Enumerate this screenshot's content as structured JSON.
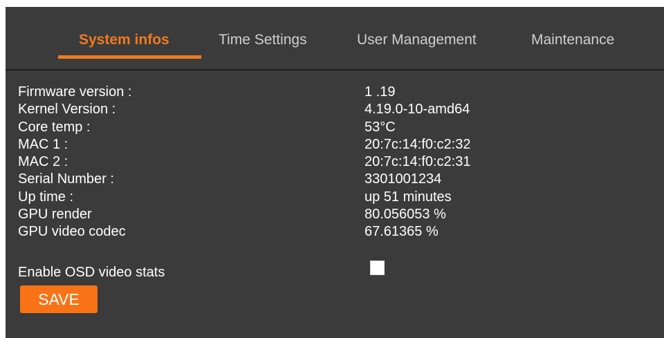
{
  "tabs": [
    {
      "label": "System infos",
      "active": true
    },
    {
      "label": "Time Settings",
      "active": false
    },
    {
      "label": "User Management",
      "active": false
    },
    {
      "label": "Maintenance",
      "active": false
    }
  ],
  "system_info": {
    "rows": [
      {
        "label": "Firmware version :",
        "value": "1 .19"
      },
      {
        "label": "Kernel Version :",
        "value": "4.19.0-10-amd64"
      },
      {
        "label": "Core temp :",
        "value": "53°C"
      },
      {
        "label": "MAC 1 :",
        "value": "20:7c:14:f0:c2:32"
      },
      {
        "label": "MAC 2 :",
        "value": "20:7c:14:f0:c2:31"
      },
      {
        "label": "Serial Number :",
        "value": "3301001234"
      },
      {
        "label": "Up time :",
        "value": "up 51 minutes"
      },
      {
        "label": "GPU render",
        "value": "80.056053 %"
      },
      {
        "label": "GPU video codec",
        "value": "67.61365 %"
      }
    ]
  },
  "osd": {
    "label": "Enable OSD video stats",
    "checked": false
  },
  "save_label": "SAVE",
  "colors": {
    "accent": "#f07a1e",
    "button": "#f97316",
    "panel_bg": "#3b3b3b",
    "text": "#ffffff",
    "tab_inactive": "#cfcfcf"
  }
}
